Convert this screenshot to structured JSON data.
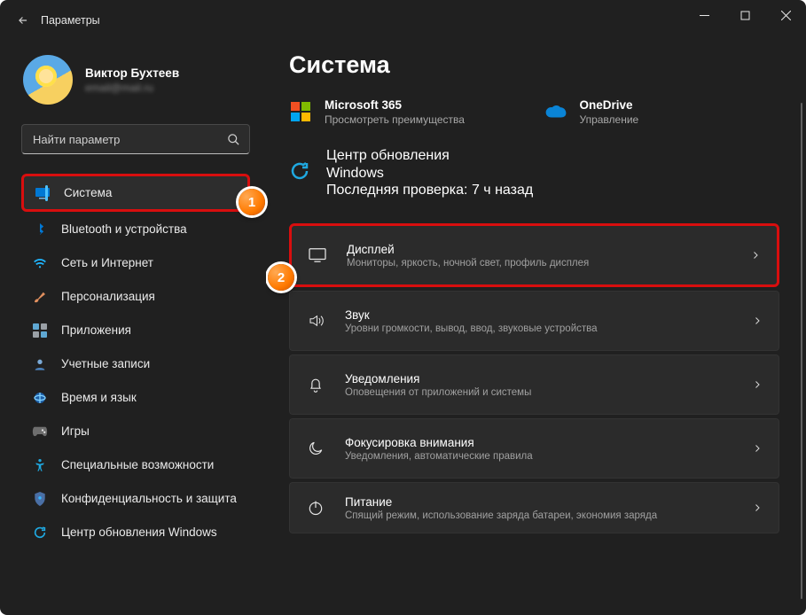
{
  "app": {
    "title": "Параметры"
  },
  "user": {
    "name": "Виктор Бухтеев",
    "email": "email@mail.ru"
  },
  "search": {
    "placeholder": "Найти параметр"
  },
  "nav": {
    "items": [
      {
        "label": "Система",
        "icon": "system"
      },
      {
        "label": "Bluetooth и устройства",
        "icon": "bluetooth"
      },
      {
        "label": "Сеть и Интернет",
        "icon": "wifi"
      },
      {
        "label": "Персонализация",
        "icon": "brush"
      },
      {
        "label": "Приложения",
        "icon": "apps"
      },
      {
        "label": "Учетные записи",
        "icon": "account"
      },
      {
        "label": "Время и язык",
        "icon": "globe"
      },
      {
        "label": "Игры",
        "icon": "games"
      },
      {
        "label": "Специальные возможности",
        "icon": "accessibility"
      },
      {
        "label": "Конфиденциальность и защита",
        "icon": "shield"
      },
      {
        "label": "Центр обновления Windows",
        "icon": "update"
      }
    ]
  },
  "page": {
    "heading": "Система",
    "tiles": [
      {
        "title": "Microsoft 365",
        "sub": "Просмотреть преимущества",
        "icon": "ms365"
      },
      {
        "title": "OneDrive",
        "sub": "Управление",
        "icon": "onedrive"
      }
    ],
    "updates": {
      "title": "Центр обновления Windows",
      "sub": "Последняя проверка: 7 ч назад",
      "icon": "update"
    },
    "cards": [
      {
        "title": "Дисплей",
        "sub": "Мониторы, яркость, ночной свет, профиль дисплея",
        "icon": "display"
      },
      {
        "title": "Звук",
        "sub": "Уровни громкости, вывод, ввод, звуковые устройства",
        "icon": "sound"
      },
      {
        "title": "Уведомления",
        "sub": "Оповещения от приложений и системы",
        "icon": "bell"
      },
      {
        "title": "Фокусировка внимания",
        "sub": "Уведомления, автоматические правила",
        "icon": "moon"
      },
      {
        "title": "Питание",
        "sub": "Спящий режим, использование заряда батареи, экономия заряда",
        "icon": "power"
      }
    ]
  },
  "annotations": {
    "steps": [
      "1",
      "2"
    ]
  }
}
